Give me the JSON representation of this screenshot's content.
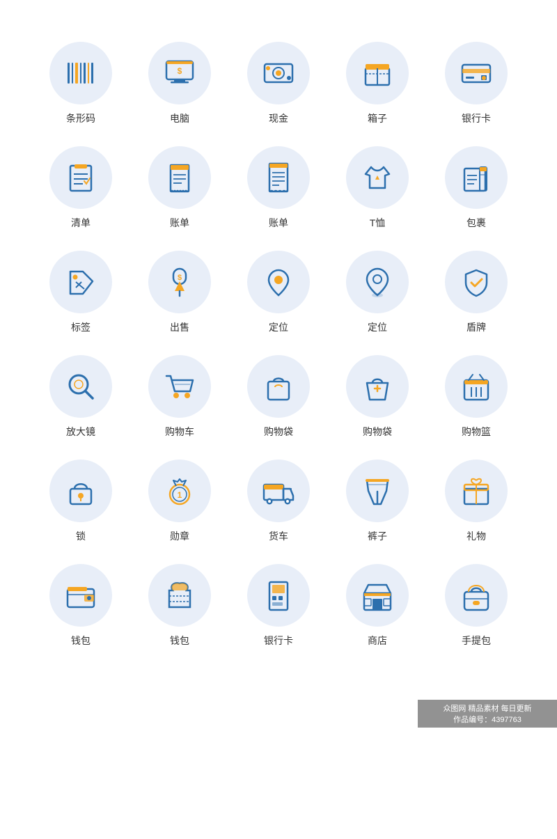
{
  "icons": [
    {
      "id": "barcode",
      "label": "条形码",
      "symbol": "barcode"
    },
    {
      "id": "computer",
      "label": "电脑",
      "symbol": "computer"
    },
    {
      "id": "cash",
      "label": "现金",
      "symbol": "cash"
    },
    {
      "id": "box",
      "label": "箱子",
      "symbol": "box"
    },
    {
      "id": "bank-card",
      "label": "银行卡",
      "symbol": "bank-card"
    },
    {
      "id": "checklist",
      "label": "清单",
      "symbol": "checklist"
    },
    {
      "id": "bill1",
      "label": "账单",
      "symbol": "bill1"
    },
    {
      "id": "bill2",
      "label": "账单",
      "symbol": "bill2"
    },
    {
      "id": "tshirt",
      "label": "T恤",
      "symbol": "tshirt"
    },
    {
      "id": "package",
      "label": "包裹",
      "symbol": "package"
    },
    {
      "id": "tag",
      "label": "标签",
      "symbol": "tag"
    },
    {
      "id": "sale",
      "label": "出售",
      "symbol": "sale"
    },
    {
      "id": "location1",
      "label": "定位",
      "symbol": "location1"
    },
    {
      "id": "location2",
      "label": "定位",
      "symbol": "location2"
    },
    {
      "id": "shield",
      "label": "盾牌",
      "symbol": "shield"
    },
    {
      "id": "magnifier",
      "label": "放大镜",
      "symbol": "magnifier"
    },
    {
      "id": "cart",
      "label": "购物车",
      "symbol": "cart"
    },
    {
      "id": "bag1",
      "label": "购物袋",
      "symbol": "bag1"
    },
    {
      "id": "bag2",
      "label": "购物袋",
      "symbol": "bag2"
    },
    {
      "id": "basket",
      "label": "购物篮",
      "symbol": "basket"
    },
    {
      "id": "lock",
      "label": "锁",
      "symbol": "lock"
    },
    {
      "id": "medal",
      "label": "勋章",
      "symbol": "medal"
    },
    {
      "id": "truck",
      "label": "货车",
      "symbol": "truck"
    },
    {
      "id": "pants",
      "label": "裤子",
      "symbol": "pants"
    },
    {
      "id": "gift",
      "label": "礼物",
      "symbol": "gift"
    },
    {
      "id": "wallet1",
      "label": "钱包",
      "symbol": "wallet1"
    },
    {
      "id": "wallet2",
      "label": "钱包",
      "symbol": "wallet2"
    },
    {
      "id": "atm",
      "label": "银行卡",
      "symbol": "atm"
    },
    {
      "id": "shop",
      "label": "商店",
      "symbol": "shop"
    },
    {
      "id": "handbag",
      "label": "手提包",
      "symbol": "handbag"
    }
  ],
  "watermark": {
    "line1": "众图网  精品素材  每日更新",
    "line2": "作品编号：4397763"
  }
}
